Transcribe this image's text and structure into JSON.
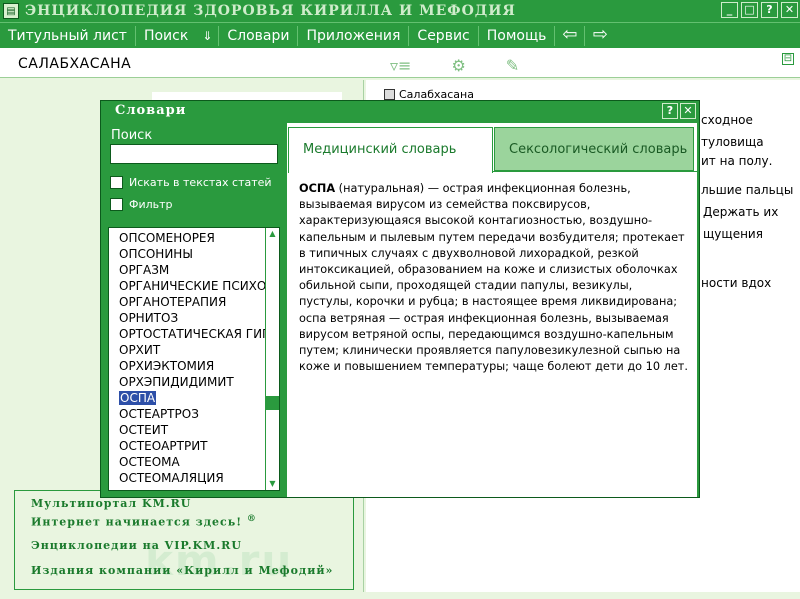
{
  "window": {
    "title": "ЭНЦИКЛОПЕДИЯ ЗДОРОВЬЯ КИРИЛЛА И МЕФОДИЯ",
    "buttons": {
      "minimize": "_",
      "maximize": "□",
      "help": "?",
      "close": "✕"
    }
  },
  "menu": {
    "items": [
      "Титульный лист",
      "Поиск",
      "Словари",
      "Приложения",
      "Сервис",
      "Помощь"
    ],
    "dropdown_arrow": "⇓",
    "back": "⇦",
    "forward": "⇨"
  },
  "article": {
    "title": "САЛАБХАСАНА",
    "toc_item": "Салабхасана",
    "collapse": "⊟",
    "background_fragments": [
      "сходное",
      "туловища",
      "ит на полу.",
      "льшие пальцы",
      "Держать их",
      "щущения",
      "ности вдох"
    ]
  },
  "promo": {
    "line1": "Мультипортал KM.RU",
    "line2": "Интернет начинается здесь!",
    "reg": "®",
    "line3": "Энциклопедии на VIP.KM.RU",
    "line4": "Издания компании «Кирилл и Мефодий»",
    "watermark": "km.ru"
  },
  "dialog": {
    "title": "Словари",
    "help": "?",
    "close": "✕",
    "search_label": "Поиск",
    "search_value": "",
    "option_fulltext": "Искать в текстах статей",
    "option_filter": "Фильтр",
    "words": [
      "ОПСОМЕНОРЕЯ",
      "ОПСОНИНЫ",
      "ОРГАЗМ",
      "ОРГАНИЧЕСКИЕ ПСИХОЗЫ",
      "ОРГАНОТЕРАПИЯ",
      "ОРНИТОЗ",
      "ОРТОСТАТИЧЕСКАЯ ГИПО",
      "ОРХИТ",
      "ОРХИЭКТОМИЯ",
      "ОРХЭПИДИДИМИТ",
      "ОСПА",
      "ОСТЕАРТРОЗ",
      "ОСТЕИТ",
      "ОСТЕОАРТРИТ",
      "ОСТЕОМА",
      "ОСТЕОМАЛЯЦИЯ"
    ],
    "selected_word": "ОСПА",
    "tabs": [
      "Медицинский словарь",
      "Сексологический словарь"
    ],
    "definition": {
      "term": "ОСПА",
      "paragraph1": " (натуральная) — острая инфекционная болезнь, вызываемая вирусом из семейства поксвирусов, характеризующаяся высокой контагиозностью, воздушно-капельным и пылевым путем передачи возбудителя; протекает в типичных случаях с двухволновой лихорадкой, резкой интоксикацией, образованием на коже и слизистых оболочках обильной сыпи, проходящей стадии папулы, везикулы, пустулы, корочки и рубца; в настоящее время ликвидирована;",
      "paragraph2": "оспа ветряная — острая инфекционная болезнь, вызываемая вирусом ветряной оспы, передающимся воздушно-капельным путем; клинически проявляется папуловезикулезной сыпью на коже и повышением температуры; чаще болеют дети до 10 лет."
    }
  },
  "colors": {
    "accent": "#2a9a3e",
    "selection": "#2d4fa8",
    "background": "#e9f5e0"
  }
}
